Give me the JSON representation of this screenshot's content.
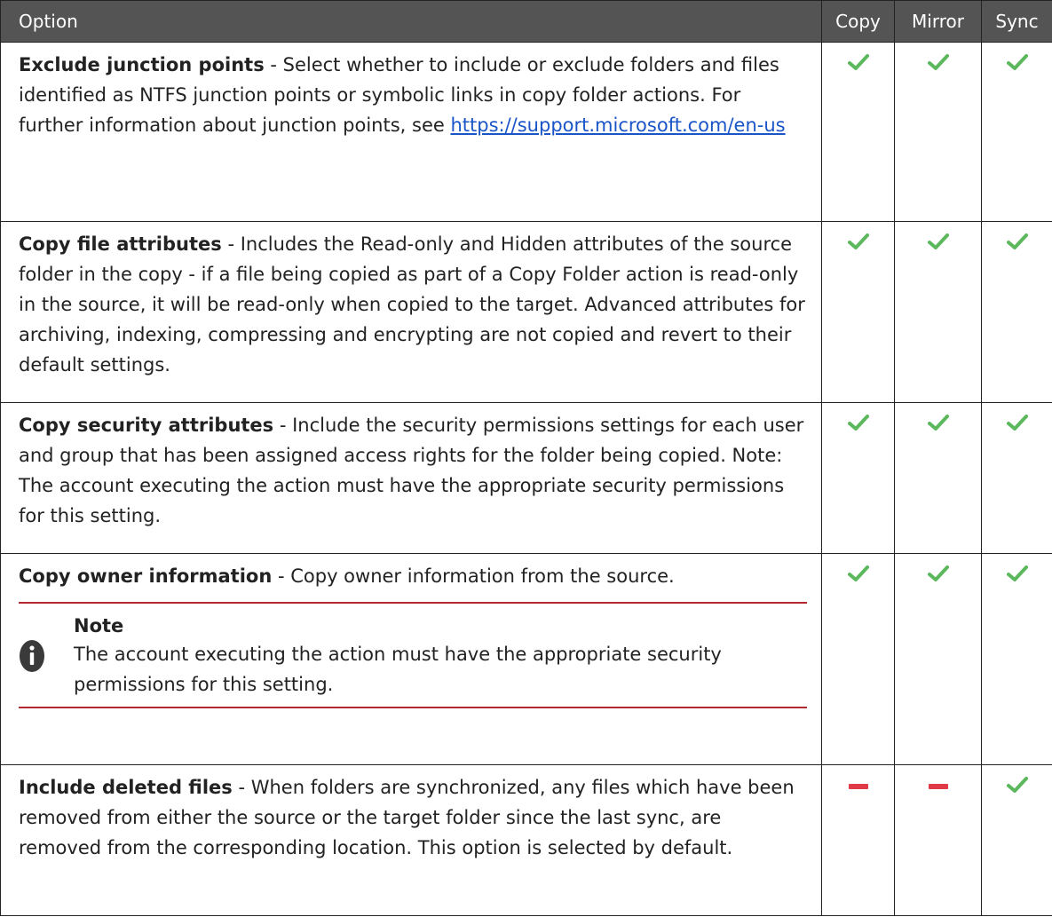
{
  "header": {
    "option": "Option",
    "copy": "Copy",
    "mirror": "Mirror",
    "sync": "Sync"
  },
  "rows": [
    {
      "title": "Exclude junction points",
      "text": " - Select whether to include or exclude folders and files identified as NTFS junction points or symbolic links in copy folder actions. For further information about junction points, see ",
      "link": "https://support.microsoft.com/en-us",
      "copy": "check",
      "mirror": "check",
      "sync": "check"
    },
    {
      "title": "Copy file attributes",
      "text": " - Includes the Read-only and Hidden attributes of the source folder in the copy - if a file being copied as part of a Copy Folder action is read-only in the source, it will be read-only when copied to the target. Advanced attributes for archiving, indexing, compressing and encrypting are not copied and revert to their default settings.",
      "copy": "check",
      "mirror": "check",
      "sync": "check"
    },
    {
      "title": "Copy security attributes",
      "text": " - Include the security permissions settings for each user and group that has been assigned access rights for the folder being copied. Note: The account executing the action must have the appropriate security permissions for this setting.",
      "copy": "check",
      "mirror": "check",
      "sync": "check"
    },
    {
      "title": "Copy owner information",
      "text": " - Copy owner information from the source.",
      "note_title": "Note",
      "note_text": " The account executing the action must have the appropriate security permissions for this setting.",
      "copy": "check",
      "mirror": "check",
      "sync": "check"
    },
    {
      "title": "Include deleted files",
      "text": " - When folders are synchronized, any files which have been removed from either the source or the target folder since the last sync, are removed from the corresponding location. This option is selected by default.",
      "copy": "dash",
      "mirror": "dash",
      "sync": "check"
    }
  ],
  "colors": {
    "header_bg": "#545454",
    "check": "#5cb85c",
    "dash": "#e03a47",
    "note_rule": "#b3292f",
    "link": "#1a55c8"
  },
  "icons": {
    "check": "checkmark-icon",
    "dash": "dash-icon",
    "note": "info-icon"
  }
}
